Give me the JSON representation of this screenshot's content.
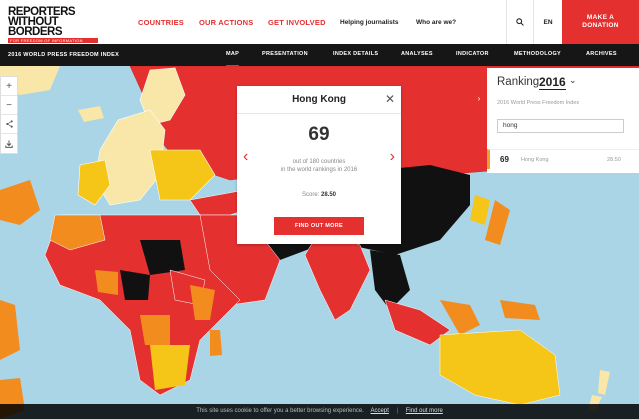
{
  "logo": {
    "line1": "REPORTERS",
    "line2": "WITHOUT BORDERS",
    "tagline": "FOR FREEDOM OF INFORMATION"
  },
  "header": {
    "nav_main": [
      "COUNTRIES",
      "OUR ACTIONS",
      "GET INVOLVED"
    ],
    "nav_secondary": [
      "Helping journalists",
      "Who are we?"
    ],
    "lang": "EN",
    "donate_line1": "MAKE A",
    "donate_line2": "DONATION"
  },
  "subnav": {
    "index_title": "2016 WORLD PRESS FREEDOM INDEX",
    "items": [
      "MAP",
      "PRESENTATION",
      "INDEX DETAILS",
      "ANALYSES",
      "INDICATOR",
      "METHODOLOGY",
      "ARCHIVES"
    ],
    "active": "MAP"
  },
  "map_tools": [
    "+",
    "−",
    "share",
    "download"
  ],
  "popup": {
    "country": "Hong Kong",
    "rank": "69",
    "desc_line1": "out of 180 countries",
    "desc_line2": "in the world rankings in 2016",
    "score_label": "Score:",
    "score_value": "28.50",
    "button": "FIND OUT MORE"
  },
  "panel": {
    "title": "Ranking",
    "year": "2016",
    "subtitle": "2016 World Press Freedom Index",
    "search_value": "hong",
    "result": {
      "rank": "69",
      "country": "Hong Kong",
      "score": "28.50"
    }
  },
  "cookie": {
    "text": "This site uses cookie to offer you a better browsing experience.",
    "accept": "Accept",
    "find_out_more": "Find out more"
  },
  "colors": {
    "accent": "#e53030",
    "ocean": "#a9d5e6",
    "good": "#f8e7a8",
    "satisfactory": "#f5c518",
    "problematic": "#f28c1f",
    "difficult": "#e53030",
    "very_serious": "#111111"
  }
}
